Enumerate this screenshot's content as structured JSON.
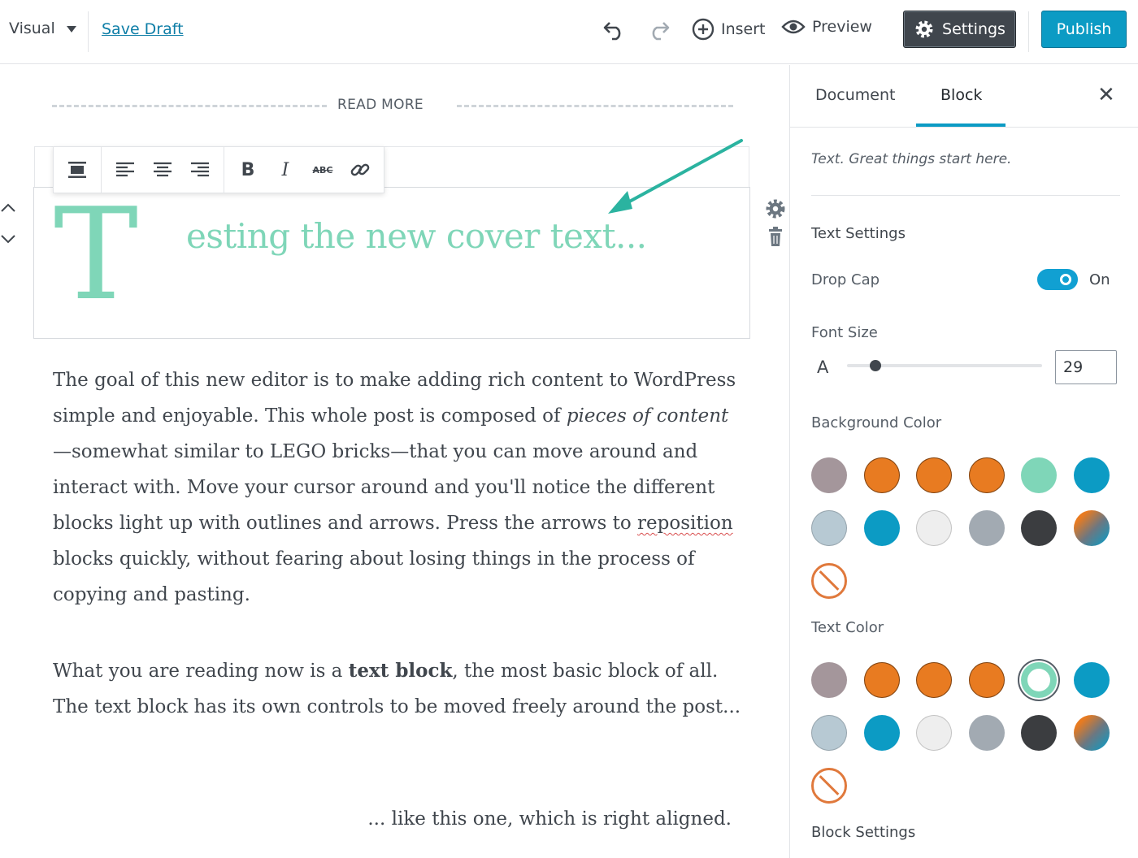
{
  "topbar": {
    "mode_label": "Visual",
    "save_draft": "Save Draft",
    "insert_label": "Insert",
    "preview_label": "Preview",
    "settings_label": "Settings",
    "publish_label": "Publish"
  },
  "editor": {
    "read_more": "READ MORE",
    "cover_dropcap": "T",
    "cover_text": "esting the new cover text...",
    "p1_a": "The goal of this new editor is to make adding rich content to WordPress simple and enjoyable. This whole post is composed of ",
    "p1_em": "pieces of content",
    "p1_b": "—somewhat similar to LEGO bricks—that you can move around and interact with. Move your cursor around and you'll notice the different blocks light up with outlines and arrows. Press the arrows to ",
    "p1_spell": "reposition",
    "p1_c": " blocks quickly, without fearing about losing things in the process of copying and pasting.",
    "p2_a": "What you are reading now is a ",
    "p2_strong": "text block",
    "p2_b": ", the most basic block of all. The text block has its own controls to be moved freely around the post...",
    "p3": "... like this one, which is right aligned."
  },
  "toolbar": {
    "bold": "B",
    "italic": "I",
    "strike": "ABC"
  },
  "sidebar": {
    "tab_document": "Document",
    "tab_block": "Block",
    "close": "✕",
    "description": "Text. Great things start here.",
    "text_settings": "Text Settings",
    "drop_cap_label": "Drop Cap",
    "drop_cap_state": "On",
    "font_size_label": "Font Size",
    "font_size_letter": "A",
    "font_size_value": "29",
    "font_size_fraction": 0.13,
    "background_color_label": "Background Color",
    "text_color_label": "Text Color",
    "block_settings_label": "Block Settings",
    "palette": [
      "#a4969b",
      "#e87b21",
      "#e87b21",
      "#e87b21",
      "#7fd6b8",
      "#0c9bc4",
      "#b7c9d3",
      "#0c9bc4",
      "#eeeeee",
      "#a2aab2",
      "#3b3d40",
      "gradient"
    ],
    "text_color_selected_index": 4
  },
  "colors": {
    "accent": "#0c9bc4",
    "cover_text": "#7fd6b8",
    "link": "#0e7ea7"
  }
}
